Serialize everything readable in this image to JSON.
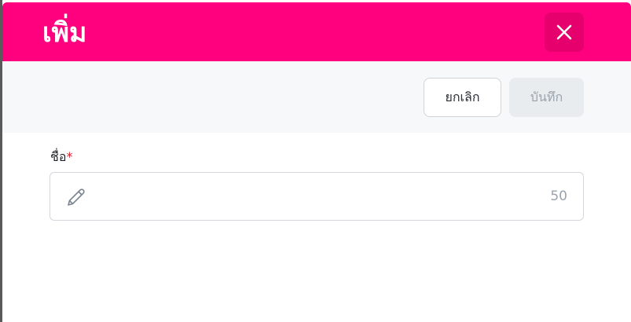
{
  "dialog": {
    "title": "เพิ่ม",
    "close_icon": "close-icon",
    "header_color": "#ff007f"
  },
  "toolbar": {
    "cancel_label": "ยกเลิก",
    "save_label": "บันทึก",
    "save_enabled": false
  },
  "form": {
    "name_field": {
      "label": "ชื่อ",
      "required_marker": "*",
      "value": "",
      "placeholder": "",
      "max_length_remaining": "50",
      "icon": "pencil-icon"
    }
  }
}
